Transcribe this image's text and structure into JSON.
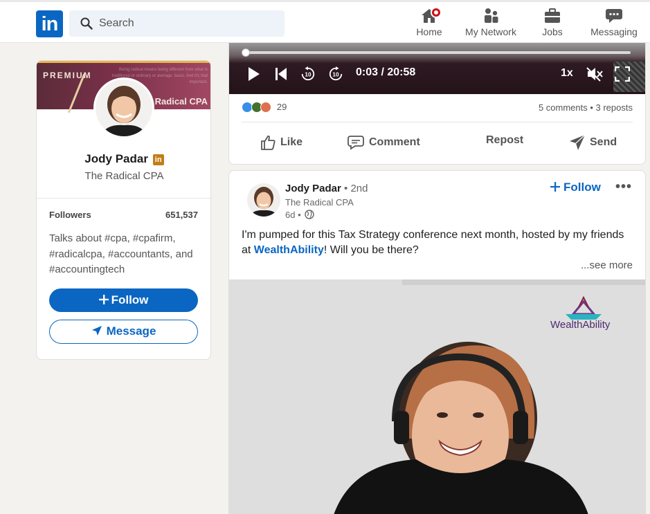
{
  "nav": {
    "logo_text": "in",
    "search_placeholder": "Search",
    "items": [
      {
        "label": "Home",
        "icon": "home-icon"
      },
      {
        "label": "My Network",
        "icon": "network-icon"
      },
      {
        "label": "Jobs",
        "icon": "briefcase-icon"
      },
      {
        "label": "Messaging",
        "icon": "messaging-icon"
      }
    ]
  },
  "profile": {
    "banner_label": "PREMIUM",
    "banner_fine": "Being radical means being different from what is traditional or ordinary or average. basic. And it's that important.",
    "banner_brand": "Radical CPA",
    "name": "Jody Padar",
    "in_badge": "in",
    "subtitle": "The Radical CPA",
    "followers_label": "Followers",
    "followers_count": "651,537",
    "talks_about": "Talks about #cpa, #cpafirm, #radicalcpa, #accountants, and #accountingtech",
    "follow_label": "Follow",
    "message_label": "Message"
  },
  "post1": {
    "time": "0:03 / 20:58",
    "speed": "1x",
    "reaction_count": "29",
    "stats": "5 comments • 3 reposts",
    "actions": {
      "like": "Like",
      "comment": "Comment",
      "repost": "Repost",
      "send": "Send"
    }
  },
  "post2": {
    "author": "Jody Padar",
    "degree": "• 2nd",
    "headline": "The Radical CPA",
    "age": "6d •",
    "follow_label": "Follow",
    "more": "•••",
    "text_before": "I'm pumped for this Tax Strategy conference next month, hosted by my friends at ",
    "text_link": "WealthAbility",
    "text_after": "! Will you be there?",
    "see_more": "...see more",
    "image_brand": "WealthAbility"
  },
  "colors": {
    "brand": "#0a66c2",
    "badge": "#cc1016",
    "premium_gold": "#c37d16"
  }
}
